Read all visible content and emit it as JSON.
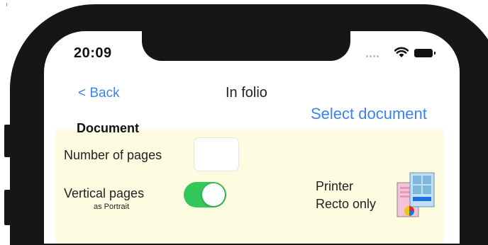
{
  "status": {
    "time": "20:09"
  },
  "nav": {
    "back_label": "< Back",
    "title": "In folio"
  },
  "actions": {
    "select_document": "Select document"
  },
  "document": {
    "section_title": "Document",
    "number_of_pages_label": "Number of pages",
    "number_of_pages_value": "",
    "vertical_pages_label": "Vertical pages",
    "vertical_pages_sub": "as Portrait",
    "vertical_pages_on": true,
    "printer_line1": "Printer",
    "printer_line2": "Recto only"
  },
  "colors": {
    "accent": "#3b82f6",
    "toggle_on": "#34c759",
    "panel_bg": "#fdfbe0",
    "frame": "#161616"
  },
  "icons": {
    "printer": "printer-recto-icon",
    "wifi": "wifi-icon",
    "battery": "battery-icon",
    "signal": "signal-icon"
  }
}
